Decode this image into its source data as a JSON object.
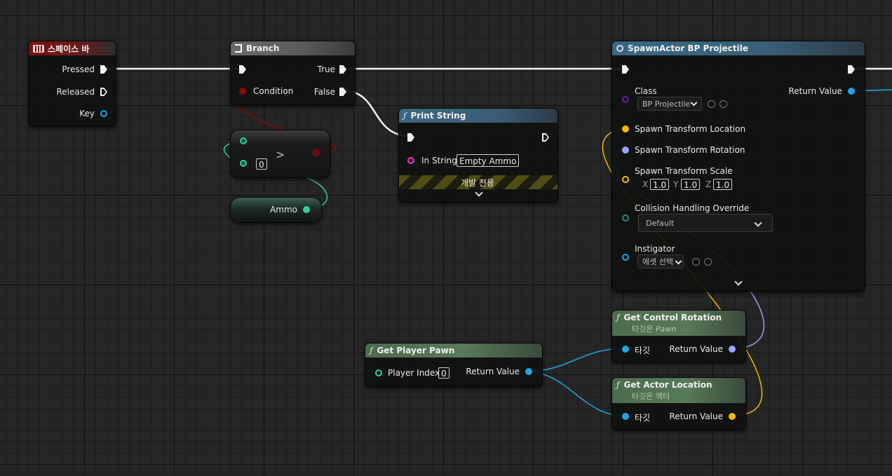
{
  "nodes": {
    "spacebar": {
      "title": "스페이스 바",
      "pressed": "Pressed",
      "released": "Released",
      "key": "Key"
    },
    "branch": {
      "title": "Branch",
      "condition": "Condition",
      "true_label": "True",
      "false_label": "False"
    },
    "compare": {
      "operator": ">",
      "value": "0"
    },
    "ammo": {
      "label": "Ammo"
    },
    "print_string": {
      "title": "Print String",
      "in_string": "In String",
      "in_string_value": "Empty Ammo",
      "dev_only": "개발 전용"
    },
    "spawn_actor": {
      "title": "SpawnActor BP Projectile",
      "class_label": "Class",
      "class_value": "BP Projectile",
      "return_value": "Return Value",
      "spawn_location": "Spawn Transform Location",
      "spawn_rotation": "Spawn Transform Rotation",
      "spawn_scale": "Spawn Transform Scale",
      "scale_x_label": "X",
      "scale_x": "1.0",
      "scale_y_label": "Y",
      "scale_y": "1.0",
      "scale_z_label": "Z",
      "scale_z": "1.0",
      "collision_label": "Collision Handling Override",
      "collision_value": "Default",
      "instigator_label": "Instigator",
      "instigator_value": "에셋 선택"
    },
    "get_control_rotation": {
      "title": "Get Control Rotation",
      "subtitle_prefix": "타깃은 ",
      "subtitle_target": "Pawn",
      "target": "타깃",
      "return_value": "Return Value"
    },
    "get_actor_location": {
      "title": "Get Actor Location",
      "subtitle": "타깃은 액터",
      "target": "타깃",
      "return_value": "Return Value"
    },
    "get_player_pawn": {
      "title": "Get Player Pawn",
      "player_index": "Player Index",
      "player_index_value": "0",
      "return_value": "Return Value"
    }
  },
  "colors": {
    "exec": "#f2f2f2",
    "bool": "#8b0a0a",
    "int": "#2ecfa0",
    "string": "#ff2de0",
    "class": "#6b1aa8",
    "vector": "#f5b800",
    "rotator": "#9aa4ff",
    "object": "#21a3e8",
    "struct": "#1f8a80"
  },
  "icons": {
    "spacebar": "keyboard-icon",
    "branch": "branch-icon",
    "spawn": "spawn-actor-icon",
    "function": "function-icon"
  }
}
